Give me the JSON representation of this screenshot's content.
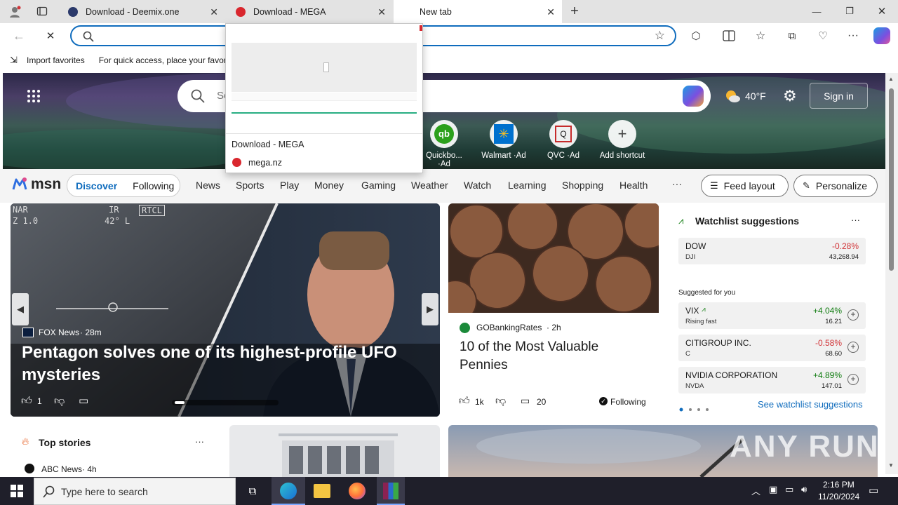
{
  "tabs": [
    {
      "title": "Download - Deemix.one",
      "active": false
    },
    {
      "title": "Download - MEGA",
      "active": false
    },
    {
      "title": "New tab",
      "active": true
    }
  ],
  "address": {
    "value": ""
  },
  "favorites_bar": {
    "import_label": "Import favorites",
    "hint": "For quick access, place your favori"
  },
  "tab_preview": {
    "title": "Download - MEGA",
    "domain": "mega.nz"
  },
  "hero": {
    "search_placeholder": "Se",
    "weather": "40°F",
    "signin_label": "Sign in",
    "shortcuts": [
      {
        "label": "Quickbo...",
        "ad": "·Ad"
      },
      {
        "label": "Walmart",
        "ad": "·Ad"
      },
      {
        "label": "QVC",
        "ad": "·Ad"
      },
      {
        "label": "Add shortcut",
        "ad": ""
      }
    ]
  },
  "msn_nav": {
    "brand": "msn",
    "toggle": [
      "Discover",
      "Following"
    ],
    "items": [
      "News",
      "Sports",
      "Play",
      "Money",
      "Gaming",
      "Weather",
      "Watch",
      "Learning",
      "Shopping",
      "Health"
    ],
    "more": "···",
    "feed_layout": "Feed layout",
    "personalize": "Personalize"
  },
  "main_story": {
    "source": "FOX News",
    "age": "· 28m",
    "headline": "Pentagon solves one of its highest-profile UFO mysteries",
    "likes": "1",
    "hud": [
      "NAR",
      "IR",
      "RTCL",
      "Z 1.0",
      "42° L"
    ]
  },
  "side_story": {
    "source": "GOBankingRates",
    "age": "· 2h",
    "headline": "10 of the Most Valuable Pennies",
    "likes": "1k",
    "comments": "20",
    "following": "Following"
  },
  "watchlist": {
    "title": "Watchlist suggestions",
    "more": "···",
    "dow": {
      "name": "DOW",
      "symbol": "DJI",
      "change": "-0.28%",
      "value": "43,268.94"
    },
    "suggested_label": "Suggested for you",
    "suggestions": [
      {
        "name": "VIX",
        "symbol": "Rising fast",
        "change": "+4.04%",
        "value": "16.21"
      },
      {
        "name": "CITIGROUP INC.",
        "symbol": "C",
        "change": "-0.58%",
        "value": "68.60"
      },
      {
        "name": "NVIDIA CORPORATION",
        "symbol": "NVDA",
        "change": "+4.89%",
        "value": "147.01"
      }
    ],
    "see_link": "See watchlist suggestions"
  },
  "top_stories": {
    "title": "Top stories",
    "more": "···",
    "first_source": "ABC News",
    "first_age": "· 4h"
  },
  "watermark": "ANY RUN",
  "taskbar": {
    "search_placeholder": "Type here to search",
    "time": "2:16 PM",
    "date": "11/20/2024"
  },
  "colors": {
    "accent": "#0f6cbd",
    "taskbar": "#1f1f2a",
    "positive": "#107c10",
    "negative": "#d13438"
  }
}
